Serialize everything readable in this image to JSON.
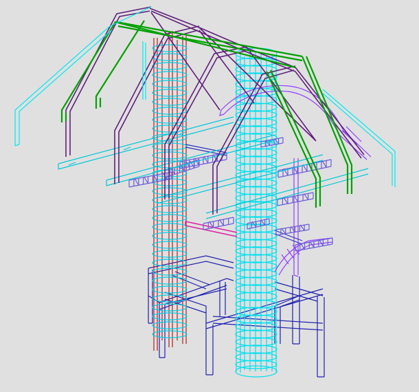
{
  "viewport": {
    "background": "#e0e0e0"
  },
  "model": {
    "colors": {
      "roof_outline": "#00e8f0",
      "rafter_green": "#00a000",
      "rafter_purple": "#60207a",
      "column_red": "#b02020",
      "column_cyan": "#00e0f0",
      "foundation_blue": "#2020b0",
      "pipe_magenta": "#e020a0",
      "support_violet": "#9040ff",
      "deck": "#6a5cd8",
      "dark": "#202040"
    },
    "icons": [
      "wireframe-3d-structure"
    ]
  }
}
